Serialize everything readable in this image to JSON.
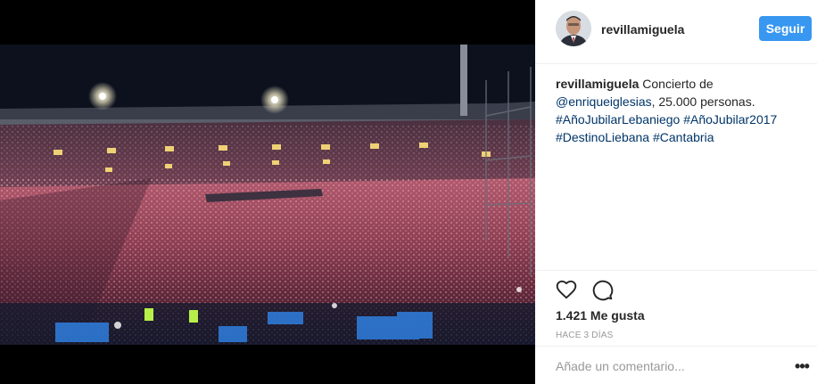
{
  "post": {
    "username": "revillamiguela",
    "follow_label": "Seguir",
    "photo_alt": "Concert crowd at a stadium at night",
    "caption": {
      "user": "revillamiguela",
      "text_1": " Concierto de ",
      "mention": "@enriqueiglesias",
      "text_2": ", 25.000 personas. ",
      "hashtags": [
        "#AñoJubilarLebaniego",
        "#AñoJubilar2017",
        "#DestinoLiebana",
        "#Cantabria"
      ]
    },
    "likes": "1.421 Me gusta",
    "timestamp": "HACE 3 DÍAS",
    "comment_placeholder": "Añade un comentario...",
    "more_label": "•••"
  },
  "icons": {
    "like": "heart-icon",
    "comment": "comment-icon",
    "more": "more-options-icon"
  },
  "colors": {
    "accent": "#3897f0",
    "link": "#003569",
    "muted": "#999999"
  }
}
